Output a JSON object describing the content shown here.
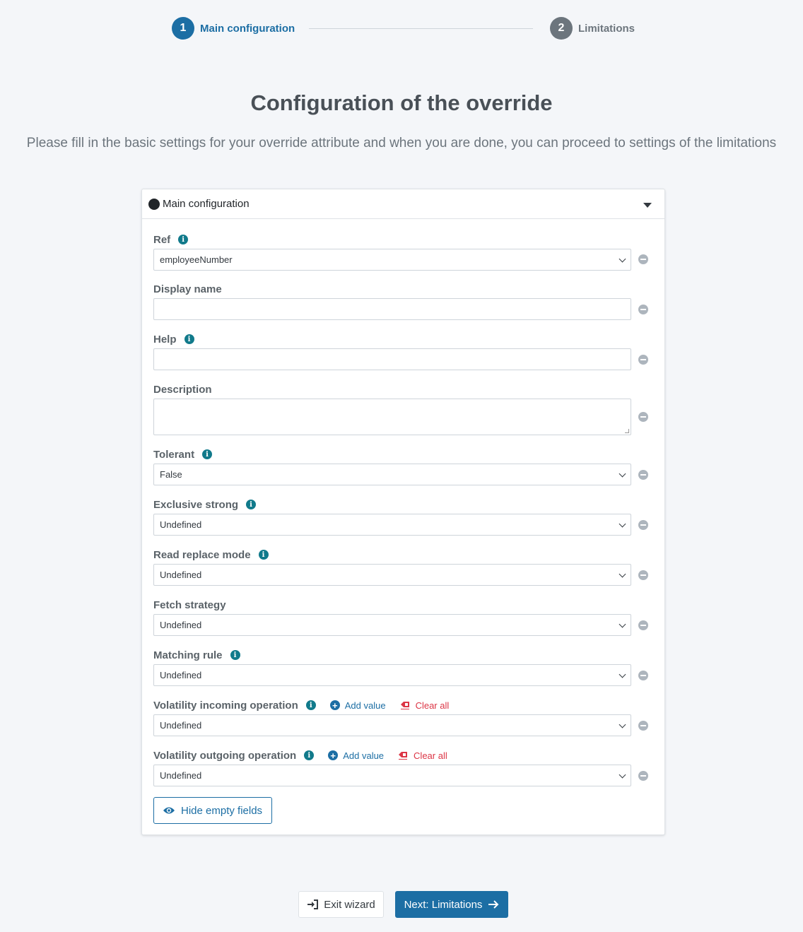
{
  "stepper": {
    "steps": [
      {
        "number": "1",
        "label": "Main configuration"
      },
      {
        "number": "2",
        "label": "Limitations"
      }
    ]
  },
  "page": {
    "title": "Configuration of the override",
    "subtitle": "Please fill in the basic settings for your override attribute and when you are done, you can proceed to settings of the limitations"
  },
  "panel": {
    "title": "Main configuration",
    "fields": {
      "ref": {
        "label": "Ref",
        "value": "employeeNumber"
      },
      "display_name": {
        "label": "Display name",
        "value": ""
      },
      "help": {
        "label": "Help",
        "value": ""
      },
      "description": {
        "label": "Description",
        "value": ""
      },
      "tolerant": {
        "label": "Tolerant",
        "value": "False"
      },
      "exclusive_strong": {
        "label": "Exclusive strong",
        "value": "Undefined"
      },
      "read_replace_mode": {
        "label": "Read replace mode",
        "value": "Undefined"
      },
      "fetch_strategy": {
        "label": "Fetch strategy",
        "value": "Undefined"
      },
      "matching_rule": {
        "label": "Matching rule",
        "value": "Undefined"
      },
      "volatility_incoming": {
        "label": "Volatility incoming operation",
        "value": "Undefined"
      },
      "volatility_outgoing": {
        "label": "Volatility outgoing operation",
        "value": "Undefined"
      }
    },
    "add_value_label": "Add value",
    "clear_all_label": "Clear all",
    "hide_empty_label": "Hide empty fields"
  },
  "footer": {
    "exit_label": "Exit wizard",
    "next_label": "Next: Limitations"
  },
  "colors": {
    "primary": "#1c6ea4",
    "info": "#117a8b",
    "danger": "#dc3545",
    "muted": "#6c757d"
  }
}
